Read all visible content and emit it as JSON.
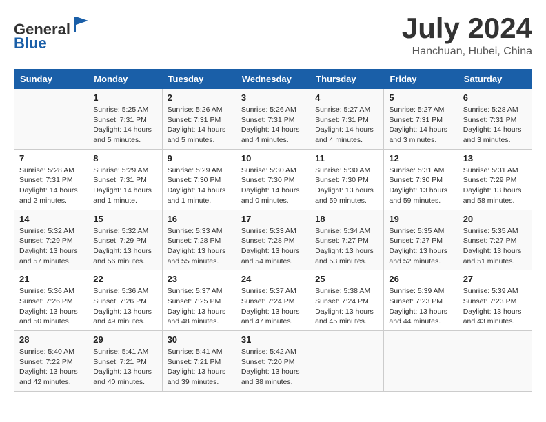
{
  "header": {
    "logo_line1": "General",
    "logo_line2": "Blue",
    "month_title": "July 2024",
    "location": "Hanchuan, Hubei, China"
  },
  "days_of_week": [
    "Sunday",
    "Monday",
    "Tuesday",
    "Wednesday",
    "Thursday",
    "Friday",
    "Saturday"
  ],
  "weeks": [
    [
      {
        "day": "",
        "info": ""
      },
      {
        "day": "1",
        "info": "Sunrise: 5:25 AM\nSunset: 7:31 PM\nDaylight: 14 hours\nand 5 minutes."
      },
      {
        "day": "2",
        "info": "Sunrise: 5:26 AM\nSunset: 7:31 PM\nDaylight: 14 hours\nand 5 minutes."
      },
      {
        "day": "3",
        "info": "Sunrise: 5:26 AM\nSunset: 7:31 PM\nDaylight: 14 hours\nand 4 minutes."
      },
      {
        "day": "4",
        "info": "Sunrise: 5:27 AM\nSunset: 7:31 PM\nDaylight: 14 hours\nand 4 minutes."
      },
      {
        "day": "5",
        "info": "Sunrise: 5:27 AM\nSunset: 7:31 PM\nDaylight: 14 hours\nand 3 minutes."
      },
      {
        "day": "6",
        "info": "Sunrise: 5:28 AM\nSunset: 7:31 PM\nDaylight: 14 hours\nand 3 minutes."
      }
    ],
    [
      {
        "day": "7",
        "info": "Sunrise: 5:28 AM\nSunset: 7:31 PM\nDaylight: 14 hours\nand 2 minutes."
      },
      {
        "day": "8",
        "info": "Sunrise: 5:29 AM\nSunset: 7:31 PM\nDaylight: 14 hours\nand 1 minute."
      },
      {
        "day": "9",
        "info": "Sunrise: 5:29 AM\nSunset: 7:30 PM\nDaylight: 14 hours\nand 1 minute."
      },
      {
        "day": "10",
        "info": "Sunrise: 5:30 AM\nSunset: 7:30 PM\nDaylight: 14 hours\nand 0 minutes."
      },
      {
        "day": "11",
        "info": "Sunrise: 5:30 AM\nSunset: 7:30 PM\nDaylight: 13 hours\nand 59 minutes."
      },
      {
        "day": "12",
        "info": "Sunrise: 5:31 AM\nSunset: 7:30 PM\nDaylight: 13 hours\nand 59 minutes."
      },
      {
        "day": "13",
        "info": "Sunrise: 5:31 AM\nSunset: 7:29 PM\nDaylight: 13 hours\nand 58 minutes."
      }
    ],
    [
      {
        "day": "14",
        "info": "Sunrise: 5:32 AM\nSunset: 7:29 PM\nDaylight: 13 hours\nand 57 minutes."
      },
      {
        "day": "15",
        "info": "Sunrise: 5:32 AM\nSunset: 7:29 PM\nDaylight: 13 hours\nand 56 minutes."
      },
      {
        "day": "16",
        "info": "Sunrise: 5:33 AM\nSunset: 7:28 PM\nDaylight: 13 hours\nand 55 minutes."
      },
      {
        "day": "17",
        "info": "Sunrise: 5:33 AM\nSunset: 7:28 PM\nDaylight: 13 hours\nand 54 minutes."
      },
      {
        "day": "18",
        "info": "Sunrise: 5:34 AM\nSunset: 7:27 PM\nDaylight: 13 hours\nand 53 minutes."
      },
      {
        "day": "19",
        "info": "Sunrise: 5:35 AM\nSunset: 7:27 PM\nDaylight: 13 hours\nand 52 minutes."
      },
      {
        "day": "20",
        "info": "Sunrise: 5:35 AM\nSunset: 7:27 PM\nDaylight: 13 hours\nand 51 minutes."
      }
    ],
    [
      {
        "day": "21",
        "info": "Sunrise: 5:36 AM\nSunset: 7:26 PM\nDaylight: 13 hours\nand 50 minutes."
      },
      {
        "day": "22",
        "info": "Sunrise: 5:36 AM\nSunset: 7:26 PM\nDaylight: 13 hours\nand 49 minutes."
      },
      {
        "day": "23",
        "info": "Sunrise: 5:37 AM\nSunset: 7:25 PM\nDaylight: 13 hours\nand 48 minutes."
      },
      {
        "day": "24",
        "info": "Sunrise: 5:37 AM\nSunset: 7:24 PM\nDaylight: 13 hours\nand 47 minutes."
      },
      {
        "day": "25",
        "info": "Sunrise: 5:38 AM\nSunset: 7:24 PM\nDaylight: 13 hours\nand 45 minutes."
      },
      {
        "day": "26",
        "info": "Sunrise: 5:39 AM\nSunset: 7:23 PM\nDaylight: 13 hours\nand 44 minutes."
      },
      {
        "day": "27",
        "info": "Sunrise: 5:39 AM\nSunset: 7:23 PM\nDaylight: 13 hours\nand 43 minutes."
      }
    ],
    [
      {
        "day": "28",
        "info": "Sunrise: 5:40 AM\nSunset: 7:22 PM\nDaylight: 13 hours\nand 42 minutes."
      },
      {
        "day": "29",
        "info": "Sunrise: 5:41 AM\nSunset: 7:21 PM\nDaylight: 13 hours\nand 40 minutes."
      },
      {
        "day": "30",
        "info": "Sunrise: 5:41 AM\nSunset: 7:21 PM\nDaylight: 13 hours\nand 39 minutes."
      },
      {
        "day": "31",
        "info": "Sunrise: 5:42 AM\nSunset: 7:20 PM\nDaylight: 13 hours\nand 38 minutes."
      },
      {
        "day": "",
        "info": ""
      },
      {
        "day": "",
        "info": ""
      },
      {
        "day": "",
        "info": ""
      }
    ]
  ]
}
